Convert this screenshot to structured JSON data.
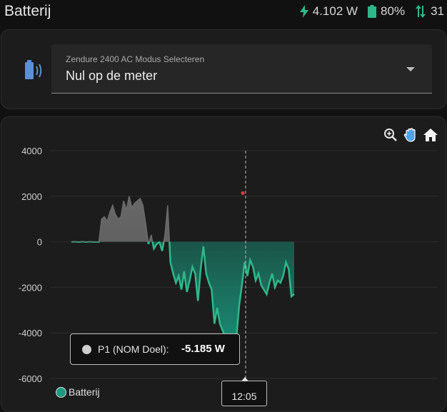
{
  "header": {
    "title": "Batterij",
    "power": "4.102 W",
    "battery": "80%",
    "transfer": "31"
  },
  "mode_select": {
    "label": "Zendure 2400 AC Modus Selecteren",
    "value": "Nul op de meter"
  },
  "toolbar": {
    "icons": [
      "zoom-in-icon",
      "pan-hand-icon",
      "home-icon"
    ]
  },
  "tooltip": {
    "series": "P1 (NOM Doel):",
    "value": "-5.185 W"
  },
  "crosshair_x_label": "12:05",
  "colors": {
    "background": "#111111",
    "card": "#1c1c1c",
    "accent_green": "#2eb88a",
    "series_fill": "#1a9a80",
    "gray_series": "#6b6b6b",
    "marker": "#e53935"
  },
  "chart_data": {
    "type": "area",
    "ylim": [
      -6000,
      4000
    ],
    "yticks": [
      "4000",
      "2000",
      "0",
      "-2000",
      "-4000",
      "-6000"
    ],
    "grid": true,
    "legend": "bottom-left",
    "series": [
      {
        "name": "Batterij",
        "values": [
          0,
          10,
          5,
          0,
          15,
          0,
          5,
          10,
          0,
          0,
          0,
          1000,
          1100,
          900,
          1300,
          1600,
          1200,
          1000,
          1100,
          1800,
          1400,
          2000,
          1500,
          1700,
          1800,
          1900,
          1600,
          800,
          -100,
          300,
          -300,
          -100,
          0,
          -400,
          300,
          1600,
          -900,
          -1400,
          -1800,
          -1500,
          -2100,
          -1300,
          -2200,
          -1700,
          -1100,
          -1400,
          -2600,
          -1200,
          -200,
          -1400,
          -1800,
          -2100,
          -3600,
          -2900,
          -3600,
          -3900,
          -4200,
          -4600,
          -5200,
          -4400,
          -4200,
          -2800,
          -1900,
          -900,
          -1500,
          -800,
          -1100,
          -1700,
          -1400,
          -1900,
          -2100,
          -2300,
          -1800,
          -1400,
          -2000,
          -1700,
          -1800,
          -1500,
          -900,
          -1200,
          -2400,
          -2300
        ]
      },
      {
        "name": "P1 (NOM Doel)",
        "values": [
          2200
        ]
      }
    ]
  }
}
